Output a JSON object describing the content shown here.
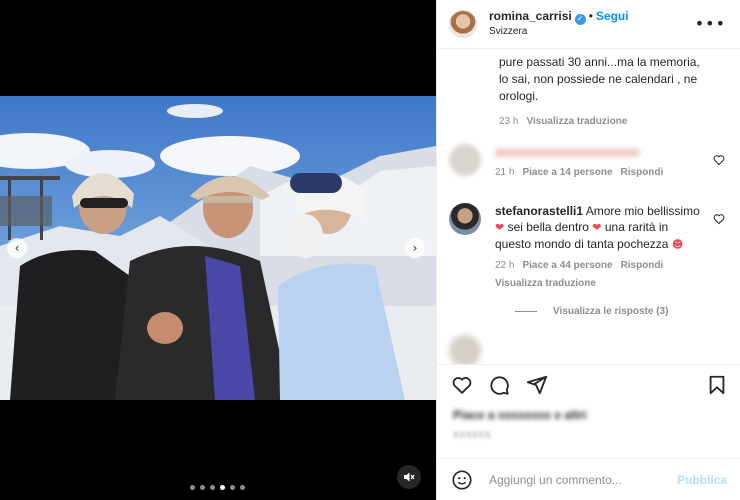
{
  "post": {
    "username": "romina_carrisi",
    "separator": "•",
    "follow_label": "Segui",
    "location": "Svizzera",
    "more_icon": "more-options-icon"
  },
  "caption": {
    "text_lines": [
      "pure passati 30 anni...ma la memoria,",
      "lo sai, non possiede ne calendari , ne",
      "orologi."
    ],
    "time": "23 h",
    "translate_label": "Visualizza traduzione"
  },
  "comments": [
    {
      "username": "",
      "blurred_text": "xxxxxxxxxxxxxxxxxxxxxxxx",
      "time": "21 h",
      "likes": "Piace a 14 persone",
      "reply_label": "Rispondi"
    },
    {
      "username": "stefanorastelli1",
      "text_part1": "Amore mio",
      "text_part2": "bellissimo",
      "text_part3": "sei bella dentro",
      "text_part4": "una rarità in questo mondo di tanta",
      "text_part5": "pochezza",
      "time": "22 h",
      "likes": "Piace a 44 persone",
      "reply_label": "Rispondi",
      "translate_label": "Visualizza traduzione"
    }
  ],
  "view_replies": "Visualizza le risposte (3)",
  "likes_summary": "Piace a xxxxxxxx e altri",
  "post_date": "XXXXXX",
  "add_comment": {
    "placeholder": "Aggiungi un commento...",
    "publish_label": "Pubblica"
  },
  "icons": {
    "heart": "heart-icon",
    "comment": "comment-icon",
    "share": "share-icon",
    "save": "bookmark-icon",
    "emoji": "emoji-icon",
    "mute": "mute-icon",
    "verified": "verified-badge-icon",
    "prev": "chevron-left-icon",
    "next": "chevron-right-icon"
  },
  "colors": {
    "accent": "#0095f6",
    "publish_disabled": "#b2dffc",
    "like_red": "#ed4956",
    "muted_text": "#8e8e8e"
  },
  "carousel": {
    "total_slides": 6,
    "active_slide": 5
  }
}
